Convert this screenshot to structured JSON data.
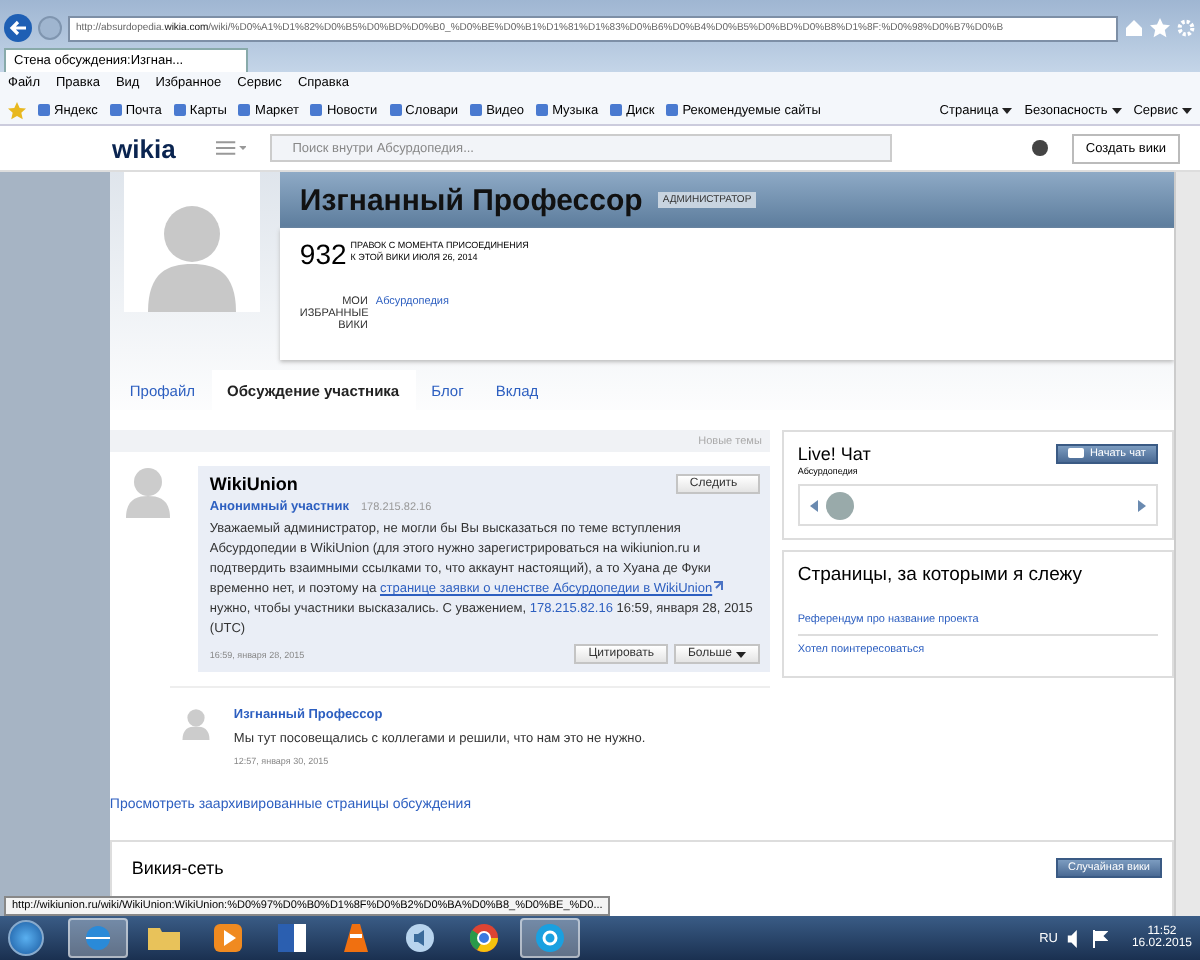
{
  "browser": {
    "url": "http://absurdopedia.**wikia.com**/wiki/%D0%A1%D1%82%D0%B5%D0%BD%D0%B0_%D0%BE%D0%B1%D1%81%D1%83%D0%B6%D0%B4%D0%B5%D0%BD%D0%B8%D1%8F:%D0%98%D0%B7%D0%B",
    "tab_title": "Стена обсуждения:Изгнан...",
    "menu": [
      "Файл",
      "Правка",
      "Вид",
      "Избранное",
      "Сервис",
      "Справка"
    ],
    "favorites": [
      "Яндекс",
      "Почта",
      "Карты",
      "Маркет",
      "Новости",
      "Словари",
      "Видео",
      "Музыка",
      "Диск",
      "Рекомендуемые сайты"
    ],
    "commands": [
      "Страница",
      "Безопасность",
      "Сервис"
    ]
  },
  "header": {
    "logo": "wikia",
    "search_placeholder": "Поиск внутри Абсурдопедия...",
    "create_button": "Создать вики"
  },
  "profile": {
    "name": "Изгнанный Профессор",
    "role": "АДМИНИСТРАТОР",
    "edit_count": "932",
    "edit_caption": [
      "ПРАВОК С МОМЕНТА ПРИСОЕДИНЕНИЯ",
      "К ЭТОЙ ВИКИ ИЮЛЯ 26, 2014"
    ],
    "favorites_label": "МОИ ИЗБРАННЫЕ ВИКИ",
    "favorite_wiki": "Абсурдопедия"
  },
  "tabs": [
    {
      "label": "Профайл",
      "selected": false
    },
    {
      "label": "Обсуждение участника",
      "selected": true
    },
    {
      "label": "Блог",
      "selected": false
    },
    {
      "label": "Вклад",
      "selected": false
    }
  ],
  "new_topics": "Новые темы",
  "thread": {
    "title": "WikiUnion",
    "follow_button": "Следить",
    "author": "Анонимный участник",
    "ip": "178.215.82.16",
    "body": [
      {
        "kind": "text",
        "text": "Уважаемый администратор, не могли бы Вы высказаться по теме вступления Абсурдопедии в WikiUnion (для этого нужно зарегистрироваться на wikiunion.ru и подтвердить взаимными ссылками то, что аккаунт настоящий), а то Хуана де Фуки временно нет, и поэтому на "
      },
      {
        "kind": "external",
        "text": "странице заявки о членстве Абсурдопедии в WikiUnion"
      },
      {
        "kind": "text",
        "text": " нужно, чтобы участники высказались. С уважением, "
      },
      {
        "kind": "link",
        "text": "178.215.82.16"
      },
      {
        "kind": "text",
        "text": " 16:59, января 28, 2015 (UTC)"
      }
    ],
    "time": "16:59, января 28, 2015",
    "quote_button": "Цитировать",
    "more_button": "Больше"
  },
  "reply": {
    "author": "Изгнанный Профессор",
    "text": "Мы тут посовещались с коллегами и решили, что нам это не нужно.",
    "time": "12:57, января 30, 2015"
  },
  "archive_link": "Просмотреть заархивированные страницы обсуждения",
  "footer": {
    "title": "Викия-сеть",
    "random_button": "Случайная вики"
  },
  "chat": {
    "title": "Live! Чат",
    "subtitle": "Абсурдопедия",
    "button": "Начать чат"
  },
  "followed": {
    "title": "Страницы, за которыми я слежу",
    "items": [
      "Референдум про название проекта",
      "Хотел поинтересоваться"
    ]
  },
  "status_url": "http://wikiunion.ru/wiki/WikiUnion:WikiUnion:%D0%97%D0%B0%D1%8F%D0%B2%D0%BA%D0%B8_%D0%BE_%D0...",
  "taskbar": {
    "apps": [
      {
        "kind": "browser",
        "selected": true
      },
      {
        "kind": "folder",
        "selected": false
      },
      {
        "kind": "player",
        "selected": false
      },
      {
        "kind": "document",
        "selected": false
      },
      {
        "kind": "cone",
        "selected": false
      },
      {
        "kind": "speaker",
        "selected": false
      },
      {
        "kind": "chrome",
        "selected": false
      },
      {
        "kind": "chat",
        "selected": true
      }
    ],
    "language": "RU",
    "time": "11:52",
    "date": "16.02.2015"
  }
}
